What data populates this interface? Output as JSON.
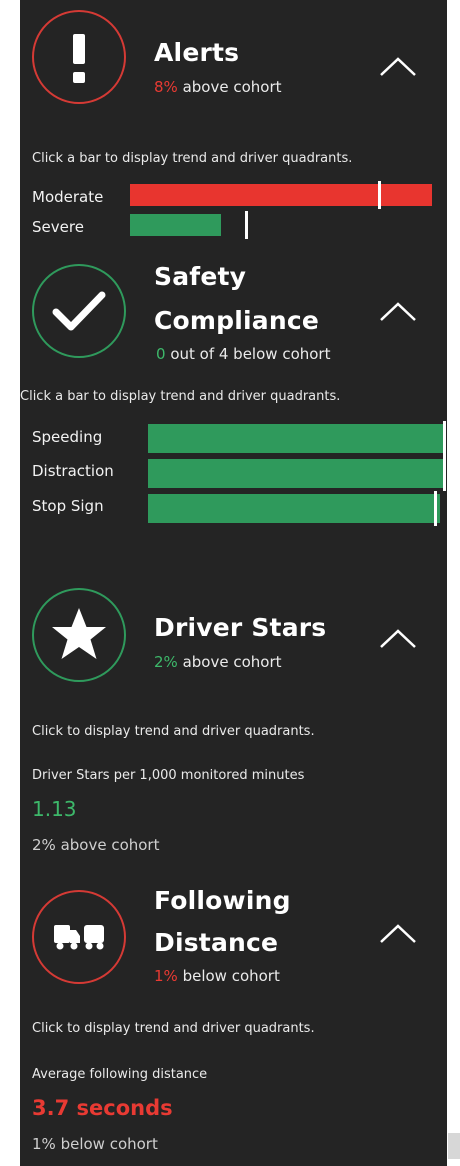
{
  "alerts": {
    "title": "Alerts",
    "pct": "8%",
    "status": " above cohort",
    "hint": "Click a bar to display trend and driver quadrants.",
    "icon": "exclamation-icon",
    "bars": [
      {
        "label": "Moderate",
        "value_fraction": 1.0,
        "cohort_marker_fraction": 0.82,
        "color": "#e8352f"
      },
      {
        "label": "Severe",
        "value_fraction": 0.3,
        "cohort_marker_fraction": 0.38,
        "color": "#2f9a5c"
      }
    ]
  },
  "safety": {
    "title_line1": "Safety",
    "title_line2": "Compliance",
    "count": "0",
    "status": " out of 4 below cohort",
    "hint": "Click a bar to display trend and driver quadrants.",
    "icon": "checkmark-icon",
    "bars": [
      {
        "label": "Speeding",
        "value_fraction": 0.99,
        "cohort_marker_fraction": 0.99,
        "color": "#2f9a5c"
      },
      {
        "label": "Distraction",
        "value_fraction": 1.0,
        "cohort_marker_fraction": 1.0,
        "color": "#2f9a5c"
      },
      {
        "label": "Stop Sign",
        "value_fraction": 0.98,
        "cohort_marker_fraction": 0.96,
        "color": "#2f9a5c"
      }
    ]
  },
  "stars": {
    "title": "Driver Stars",
    "pct": "2%",
    "status": " above cohort",
    "hint": "Click to display trend and driver quadrants.",
    "metric_label": "Driver Stars per 1,000 monitored minutes",
    "metric_value": "1.13",
    "metric_sub": "2% above cohort",
    "icon": "star-icon"
  },
  "following": {
    "title_line1": "Following",
    "title_line2": "Distance",
    "pct": "1%",
    "status": " below cohort",
    "hint": "Click to display trend and driver quadrants.",
    "metric_label": "Average following distance",
    "metric_value": "3.7 seconds",
    "metric_sub": "1% below cohort",
    "icon": "trucks-icon"
  },
  "colors": {
    "panel_bg": "#242424",
    "red": "#e83a33",
    "green": "#2f9a5c",
    "text": "#ffffff"
  }
}
